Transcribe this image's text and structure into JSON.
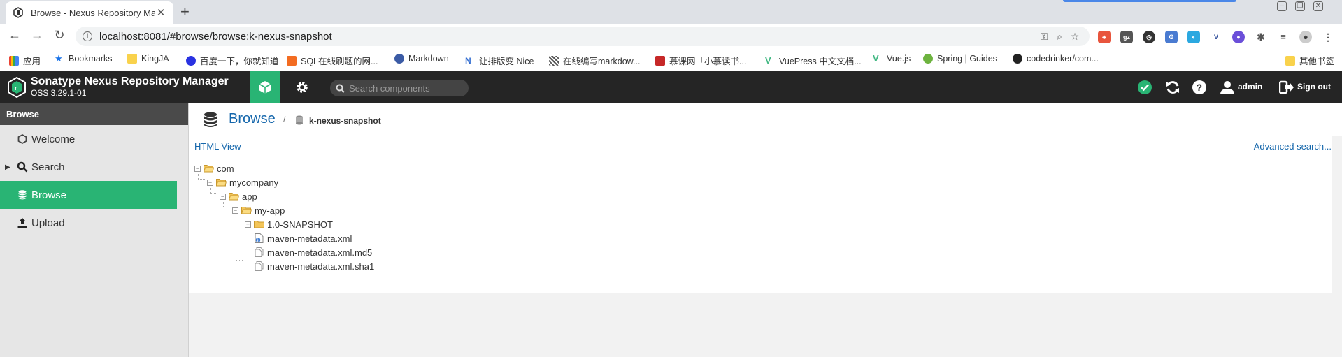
{
  "browser": {
    "tab_title": "Browse - Nexus Repository Ma",
    "url": "localhost:8081/#browse/browse:k-nexus-snapshot",
    "bookmarks": [
      {
        "label": "应用",
        "icon": "apps-grid-icon",
        "color": "#4285f4"
      },
      {
        "label": "Bookmarks",
        "icon": "star-icon",
        "color": "#1a73e8"
      },
      {
        "label": "KingJA",
        "icon": "folder-icon",
        "color": "#f9d24c"
      },
      {
        "label": "百度一下，你就知道",
        "icon": "baidu-icon",
        "color": "#2932e1"
      },
      {
        "label": "SQL在线刷题的网...",
        "icon": "sql-icon",
        "color": "#f36c21"
      },
      {
        "label": "Markdown",
        "icon": "markdown-icon",
        "color": "#3b5ba5"
      },
      {
        "label": "让排版变 Nice",
        "icon": "nice-icon",
        "color": "#2f6bd0"
      },
      {
        "label": "在线编写markdow...",
        "icon": "qr-icon",
        "color": "#555555"
      },
      {
        "label": "慕课网「小慕读书...",
        "icon": "imooc-icon",
        "color": "#c62828"
      },
      {
        "label": "VuePress 中文文档...",
        "icon": "vue-icon",
        "color": "#42b883"
      },
      {
        "label": "Vue.js",
        "icon": "vue-icon",
        "color": "#42b883"
      },
      {
        "label": "Spring | Guides",
        "icon": "spring-icon",
        "color": "#6db33f"
      },
      {
        "label": "codedrinker/com...",
        "icon": "github-icon",
        "color": "#222222"
      },
      {
        "label": "其他书签",
        "icon": "folder-icon",
        "color": "#f9d24c"
      }
    ]
  },
  "header": {
    "product_name": "Sonatype Nexus Repository Manager",
    "version": "OSS 3.29.1-01",
    "search_placeholder": "Search components",
    "user": "admin",
    "signout": "Sign out"
  },
  "sidebar": {
    "title": "Browse",
    "items": [
      {
        "label": "Welcome",
        "icon": "hexagon-icon"
      },
      {
        "label": "Search",
        "icon": "search-icon"
      },
      {
        "label": "Browse",
        "icon": "database-icon"
      },
      {
        "label": "Upload",
        "icon": "upload-icon"
      }
    ]
  },
  "main": {
    "breadcrumb_root": "Browse",
    "breadcrumb_sep": "/",
    "repository": "k-nexus-snapshot",
    "html_view": "HTML View",
    "advanced_search": "Advanced search...",
    "tree": [
      {
        "label": "com",
        "type": "folder",
        "depth": 0
      },
      {
        "label": "mycompany",
        "type": "folder",
        "depth": 1
      },
      {
        "label": "app",
        "type": "folder",
        "depth": 2
      },
      {
        "label": "my-app",
        "type": "folder",
        "depth": 3
      },
      {
        "label": "1.0-SNAPSHOT",
        "type": "folder",
        "depth": 4
      },
      {
        "label": "maven-metadata.xml",
        "type": "file",
        "depth": 4
      },
      {
        "label": "maven-metadata.xml.md5",
        "type": "file",
        "depth": 4
      },
      {
        "label": "maven-metadata.xml.sha1",
        "type": "file",
        "depth": 4
      }
    ]
  },
  "colors": {
    "accent": "#29b474",
    "header_bg": "#252525",
    "link": "#1466ab"
  }
}
